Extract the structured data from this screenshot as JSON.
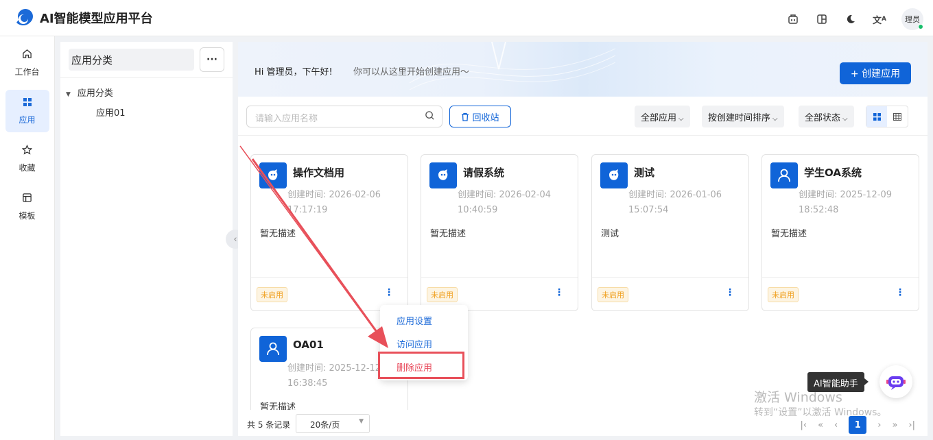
{
  "header": {
    "title": "AI智能模型应用平台",
    "avatar_text": "理员",
    "icons": [
      "app-store-icon",
      "layout-icon",
      "moon-icon",
      "translate-icon"
    ]
  },
  "nav": {
    "items": [
      {
        "label": "工作台",
        "icon": "home-icon"
      },
      {
        "label": "应用",
        "icon": "apps-icon",
        "active": true
      },
      {
        "label": "收藏",
        "icon": "star-icon"
      },
      {
        "label": "模板",
        "icon": "template-icon"
      }
    ]
  },
  "category": {
    "title": "应用分类",
    "more": "···",
    "tree": {
      "root": "应用分类",
      "child": "应用01"
    }
  },
  "banner": {
    "greeting": "Hi 管理员，下午好!",
    "subtitle": "你可以从这里开始创建应用〜",
    "create_label": "+ 创建应用"
  },
  "filters": {
    "search_placeholder": "请输入应用名称",
    "recycle_label": "回收站",
    "all_apps": "全部应用",
    "sort": "按创建时间排序",
    "status": "全部状态"
  },
  "cards": [
    {
      "name": "操作文档用",
      "time_label": "创建时间: 2026-02-06",
      "time2": "17:17:19",
      "desc": "暂无描述",
      "status": "未启用",
      "icon": "bot-icon"
    },
    {
      "name": "请假系统",
      "time_label": "创建时间: 2026-02-04",
      "time2": "10:40:59",
      "desc": "暂无描述",
      "status": "未启用",
      "icon": "bot-icon"
    },
    {
      "name": "测试",
      "time_label": "创建时间: 2026-01-06",
      "time2": "15:07:54",
      "desc": "测试",
      "status": "未启用",
      "icon": "bot-icon"
    },
    {
      "name": "学生OA系统",
      "time_label": "创建时间: 2025-12-09",
      "time2": "18:52:48",
      "desc": "暂无描述",
      "status": "未启用",
      "icon": "user-icon"
    },
    {
      "name": "OA01",
      "time_label": "创建时间: 2025-12-12",
      "time2": "16:38:45",
      "desc": "暂无描述",
      "icon": "user-icon"
    }
  ],
  "menu": {
    "settings": "应用设置",
    "visit": "访问应用",
    "delete": "删除应用"
  },
  "pagination": {
    "total": "共 5 条记录",
    "page_size": "20条/页",
    "current": "1"
  },
  "watermark": {
    "line1": "激活 Windows",
    "line2": "转到“设置”以激活 Windows。"
  },
  "assistant": {
    "tooltip": "AI智能助手"
  },
  "colors": {
    "primary": "#1064d8",
    "danger": "#e8485a",
    "warning": "#f0a020"
  }
}
